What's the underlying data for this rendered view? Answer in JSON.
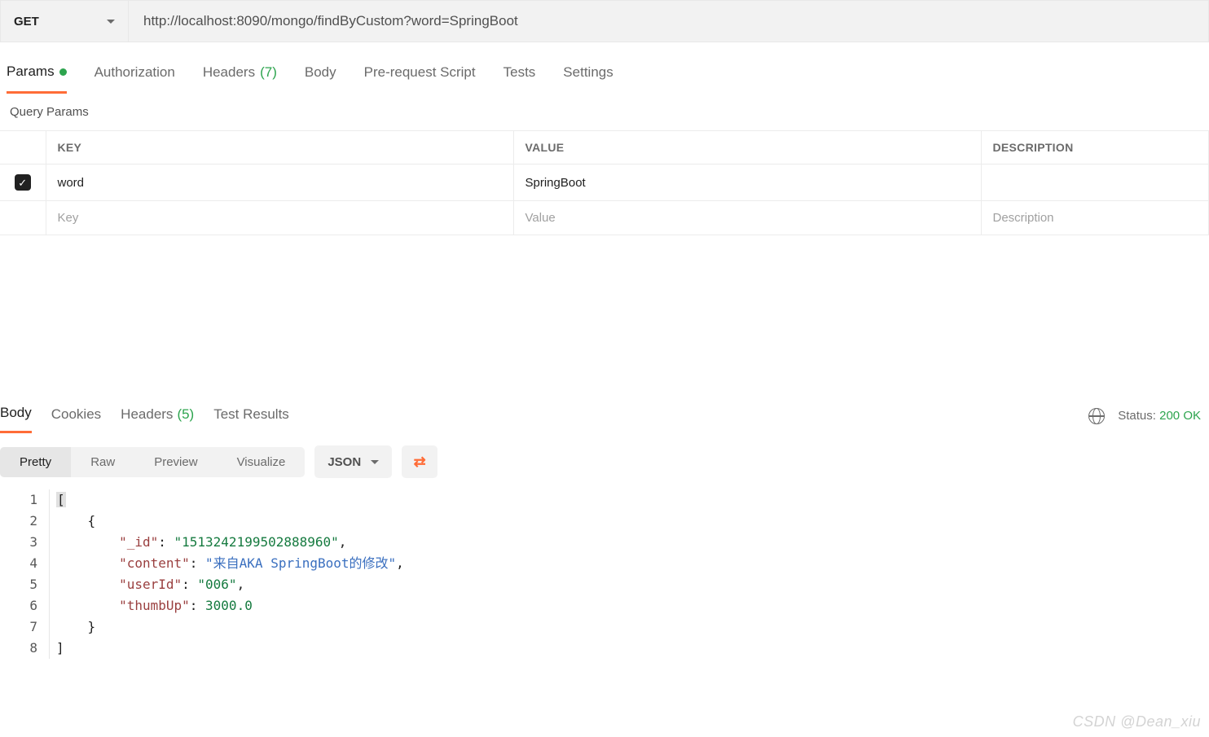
{
  "request": {
    "method": "GET",
    "url": "http://localhost:8090/mongo/findByCustom?word=SpringBoot"
  },
  "tabs": [
    {
      "label": "Params",
      "active": true,
      "dot": true
    },
    {
      "label": "Authorization"
    },
    {
      "label": "Headers",
      "count": "(7)"
    },
    {
      "label": "Body"
    },
    {
      "label": "Pre-request Script"
    },
    {
      "label": "Tests"
    },
    {
      "label": "Settings"
    }
  ],
  "params_section_title": "Query Params",
  "params_headers": {
    "key": "KEY",
    "value": "VALUE",
    "description": "DESCRIPTION"
  },
  "params_rows": [
    {
      "checked": true,
      "key": "word",
      "value": "SpringBoot",
      "description": ""
    }
  ],
  "params_placeholders": {
    "key": "Key",
    "value": "Value",
    "description": "Description"
  },
  "response_tabs": [
    {
      "label": "Body",
      "active": true
    },
    {
      "label": "Cookies"
    },
    {
      "label": "Headers",
      "count": "(5)"
    },
    {
      "label": "Test Results"
    }
  ],
  "status": {
    "label": "Status:",
    "code": "200 OK"
  },
  "body_view": {
    "segments": [
      "Pretty",
      "Raw",
      "Preview",
      "Visualize"
    ],
    "active_segment": "Pretty",
    "format": "JSON"
  },
  "code_lines": [
    {
      "n": "1",
      "indent": 0,
      "type": "bracket",
      "text": "["
    },
    {
      "n": "2",
      "indent": 1,
      "type": "bracket",
      "text": "{"
    },
    {
      "n": "3",
      "indent": 2,
      "type": "kv-str",
      "key": "\"_id\"",
      "val": "\"1513242199502888960\"",
      "comma": true
    },
    {
      "n": "4",
      "indent": 2,
      "type": "kv-str-cn",
      "key": "\"content\"",
      "val": "\"来自AKA SpringBoot的修改\"",
      "comma": true
    },
    {
      "n": "5",
      "indent": 2,
      "type": "kv-str",
      "key": "\"userId\"",
      "val": "\"006\"",
      "comma": true
    },
    {
      "n": "6",
      "indent": 2,
      "type": "kv-num",
      "key": "\"thumbUp\"",
      "val": "3000.0",
      "comma": false
    },
    {
      "n": "7",
      "indent": 1,
      "type": "bracket",
      "text": "}"
    },
    {
      "n": "8",
      "indent": 0,
      "type": "bracket",
      "text": "]"
    }
  ],
  "watermark": "CSDN @Dean_xiu"
}
